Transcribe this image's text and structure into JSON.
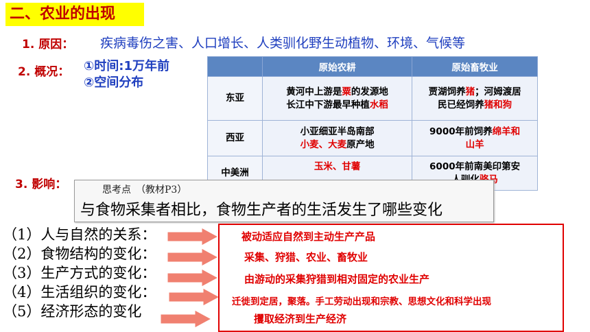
{
  "title": "二、农业的出现",
  "cause": {
    "label": "1. 原因：",
    "text": "疾病毒伤之害、人口增长、人类驯化野生动植物、环境、气候等"
  },
  "overview": {
    "label": "2. 概况：",
    "items": [
      "①时间:1万年前",
      "②空间分布"
    ]
  },
  "table": {
    "headers": [
      "",
      "原始农耕",
      "原始畜牧业"
    ],
    "rows": [
      {
        "region": "东亚",
        "farming": [
          [
            "黄河中上游是",
            "粟",
            "的发源地"
          ],
          [
            "长江中下游最早种植",
            "水稻",
            ""
          ]
        ],
        "herding": [
          [
            "贾湖饲养",
            "猪",
            "；河姆渡居"
          ],
          [
            "民已经饲养",
            "猪和狗",
            ""
          ]
        ]
      },
      {
        "region": "西亚",
        "farming": [
          [
            "小亚细亚半岛南部",
            "",
            ""
          ],
          [
            "",
            "小麦、大麦",
            "原产地"
          ]
        ],
        "herding": [
          [
            "9000年前饲养",
            "绵羊和",
            ""
          ],
          [
            "",
            "山羊",
            ""
          ]
        ]
      },
      {
        "region": "中美洲",
        "farming": [
          [
            "",
            "玉米、甘薯",
            ""
          ]
        ],
        "herding": [
          [
            "6000年前南美印第安",
            "",
            ""
          ],
          [
            "人驯化",
            "骆马",
            ""
          ]
        ]
      }
    ]
  },
  "impact": {
    "label": "3. 影响："
  },
  "think": {
    "sub": "思考点　（教材P3）",
    "question": "与食物采集者相比，食物生产者的生活发生了哪些变化"
  },
  "questions": [
    "（1）人与自然的关系：",
    "（2）食物结构的变化：",
    "（3）生产方式的变化：",
    "（4）生活组织的变化：",
    "（5）经济形态的变化"
  ],
  "answers": [
    "被动适应自然到主动生产产品",
    "采集、狩猎、农业、畜牧业",
    "由游动的采集狩猎到相对固定的农业生产",
    "迁徙到定居，聚落。手工劳动出现和宗教、思想文化和科学出现",
    "攫取经济到生产经济"
  ],
  "colors": {
    "accent_red": "#e00000",
    "title_bg": "#ffff00",
    "header_blue": "#5b86c2",
    "text_blue": "#1f3fbf",
    "arrow_fill": "#f08070"
  }
}
